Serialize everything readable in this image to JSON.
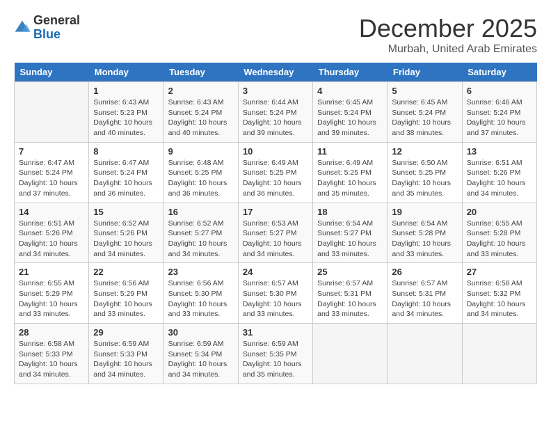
{
  "logo": {
    "general": "General",
    "blue": "Blue"
  },
  "title": "December 2025",
  "location": "Murbah, United Arab Emirates",
  "days_of_week": [
    "Sunday",
    "Monday",
    "Tuesday",
    "Wednesday",
    "Thursday",
    "Friday",
    "Saturday"
  ],
  "weeks": [
    [
      {
        "day": "",
        "info": ""
      },
      {
        "day": "1",
        "info": "Sunrise: 6:43 AM\nSunset: 5:23 PM\nDaylight: 10 hours and 40 minutes."
      },
      {
        "day": "2",
        "info": "Sunrise: 6:43 AM\nSunset: 5:24 PM\nDaylight: 10 hours and 40 minutes."
      },
      {
        "day": "3",
        "info": "Sunrise: 6:44 AM\nSunset: 5:24 PM\nDaylight: 10 hours and 39 minutes."
      },
      {
        "day": "4",
        "info": "Sunrise: 6:45 AM\nSunset: 5:24 PM\nDaylight: 10 hours and 39 minutes."
      },
      {
        "day": "5",
        "info": "Sunrise: 6:45 AM\nSunset: 5:24 PM\nDaylight: 10 hours and 38 minutes."
      },
      {
        "day": "6",
        "info": "Sunrise: 6:46 AM\nSunset: 5:24 PM\nDaylight: 10 hours and 37 minutes."
      }
    ],
    [
      {
        "day": "7",
        "info": "Sunrise: 6:47 AM\nSunset: 5:24 PM\nDaylight: 10 hours and 37 minutes."
      },
      {
        "day": "8",
        "info": "Sunrise: 6:47 AM\nSunset: 5:24 PM\nDaylight: 10 hours and 36 minutes."
      },
      {
        "day": "9",
        "info": "Sunrise: 6:48 AM\nSunset: 5:25 PM\nDaylight: 10 hours and 36 minutes."
      },
      {
        "day": "10",
        "info": "Sunrise: 6:49 AM\nSunset: 5:25 PM\nDaylight: 10 hours and 36 minutes."
      },
      {
        "day": "11",
        "info": "Sunrise: 6:49 AM\nSunset: 5:25 PM\nDaylight: 10 hours and 35 minutes."
      },
      {
        "day": "12",
        "info": "Sunrise: 6:50 AM\nSunset: 5:25 PM\nDaylight: 10 hours and 35 minutes."
      },
      {
        "day": "13",
        "info": "Sunrise: 6:51 AM\nSunset: 5:26 PM\nDaylight: 10 hours and 34 minutes."
      }
    ],
    [
      {
        "day": "14",
        "info": "Sunrise: 6:51 AM\nSunset: 5:26 PM\nDaylight: 10 hours and 34 minutes."
      },
      {
        "day": "15",
        "info": "Sunrise: 6:52 AM\nSunset: 5:26 PM\nDaylight: 10 hours and 34 minutes."
      },
      {
        "day": "16",
        "info": "Sunrise: 6:52 AM\nSunset: 5:27 PM\nDaylight: 10 hours and 34 minutes."
      },
      {
        "day": "17",
        "info": "Sunrise: 6:53 AM\nSunset: 5:27 PM\nDaylight: 10 hours and 34 minutes."
      },
      {
        "day": "18",
        "info": "Sunrise: 6:54 AM\nSunset: 5:27 PM\nDaylight: 10 hours and 33 minutes."
      },
      {
        "day": "19",
        "info": "Sunrise: 6:54 AM\nSunset: 5:28 PM\nDaylight: 10 hours and 33 minutes."
      },
      {
        "day": "20",
        "info": "Sunrise: 6:55 AM\nSunset: 5:28 PM\nDaylight: 10 hours and 33 minutes."
      }
    ],
    [
      {
        "day": "21",
        "info": "Sunrise: 6:55 AM\nSunset: 5:29 PM\nDaylight: 10 hours and 33 minutes."
      },
      {
        "day": "22",
        "info": "Sunrise: 6:56 AM\nSunset: 5:29 PM\nDaylight: 10 hours and 33 minutes."
      },
      {
        "day": "23",
        "info": "Sunrise: 6:56 AM\nSunset: 5:30 PM\nDaylight: 10 hours and 33 minutes."
      },
      {
        "day": "24",
        "info": "Sunrise: 6:57 AM\nSunset: 5:30 PM\nDaylight: 10 hours and 33 minutes."
      },
      {
        "day": "25",
        "info": "Sunrise: 6:57 AM\nSunset: 5:31 PM\nDaylight: 10 hours and 33 minutes."
      },
      {
        "day": "26",
        "info": "Sunrise: 6:57 AM\nSunset: 5:31 PM\nDaylight: 10 hours and 34 minutes."
      },
      {
        "day": "27",
        "info": "Sunrise: 6:58 AM\nSunset: 5:32 PM\nDaylight: 10 hours and 34 minutes."
      }
    ],
    [
      {
        "day": "28",
        "info": "Sunrise: 6:58 AM\nSunset: 5:33 PM\nDaylight: 10 hours and 34 minutes."
      },
      {
        "day": "29",
        "info": "Sunrise: 6:59 AM\nSunset: 5:33 PM\nDaylight: 10 hours and 34 minutes."
      },
      {
        "day": "30",
        "info": "Sunrise: 6:59 AM\nSunset: 5:34 PM\nDaylight: 10 hours and 34 minutes."
      },
      {
        "day": "31",
        "info": "Sunrise: 6:59 AM\nSunset: 5:35 PM\nDaylight: 10 hours and 35 minutes."
      },
      {
        "day": "",
        "info": ""
      },
      {
        "day": "",
        "info": ""
      },
      {
        "day": "",
        "info": ""
      }
    ]
  ]
}
